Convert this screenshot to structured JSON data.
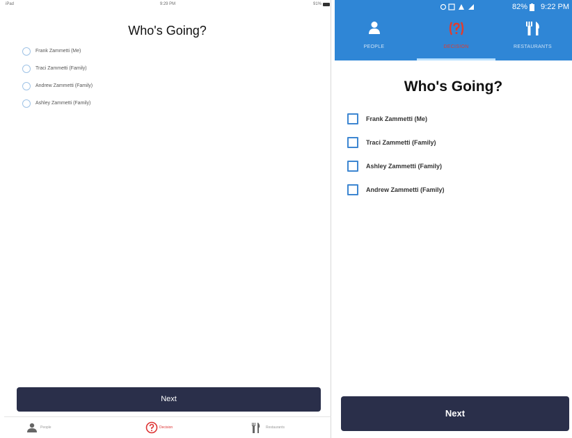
{
  "ios": {
    "status": {
      "device": "iPad",
      "time": "9:29 PM",
      "battery": "91%"
    },
    "title": "Who's Going?",
    "people": [
      "Frank Zammetti (Me)",
      "Traci Zammetti (Family)",
      "Andrew Zammetti (Family)",
      "Ashley Zammetti (Family)"
    ],
    "next_label": "Next",
    "tabs": [
      {
        "label": "People",
        "icon": "person-icon"
      },
      {
        "label": "Decision",
        "icon": "question-icon",
        "active": true
      },
      {
        "label": "Restaurants",
        "icon": "utensils-icon"
      }
    ]
  },
  "android": {
    "status": {
      "battery": "82%",
      "time": "9:22 PM"
    },
    "tabs": [
      {
        "label": "PEOPLE",
        "icon": "person-icon"
      },
      {
        "label": "DECISION",
        "icon": "question-icon",
        "active": true
      },
      {
        "label": "RESTAURANTS",
        "icon": "utensils-icon"
      }
    ],
    "title": "Who's Going?",
    "people": [
      "Frank Zammetti (Me)",
      "Traci Zammetti (Family)",
      "Ashley Zammetti (Family)",
      "Andrew Zammetti (Family)"
    ],
    "next_label": "Next"
  },
  "colors": {
    "android_bar": "#2f86d6",
    "button_bg": "#2a2f4a",
    "active_red": "#e23c2d"
  }
}
